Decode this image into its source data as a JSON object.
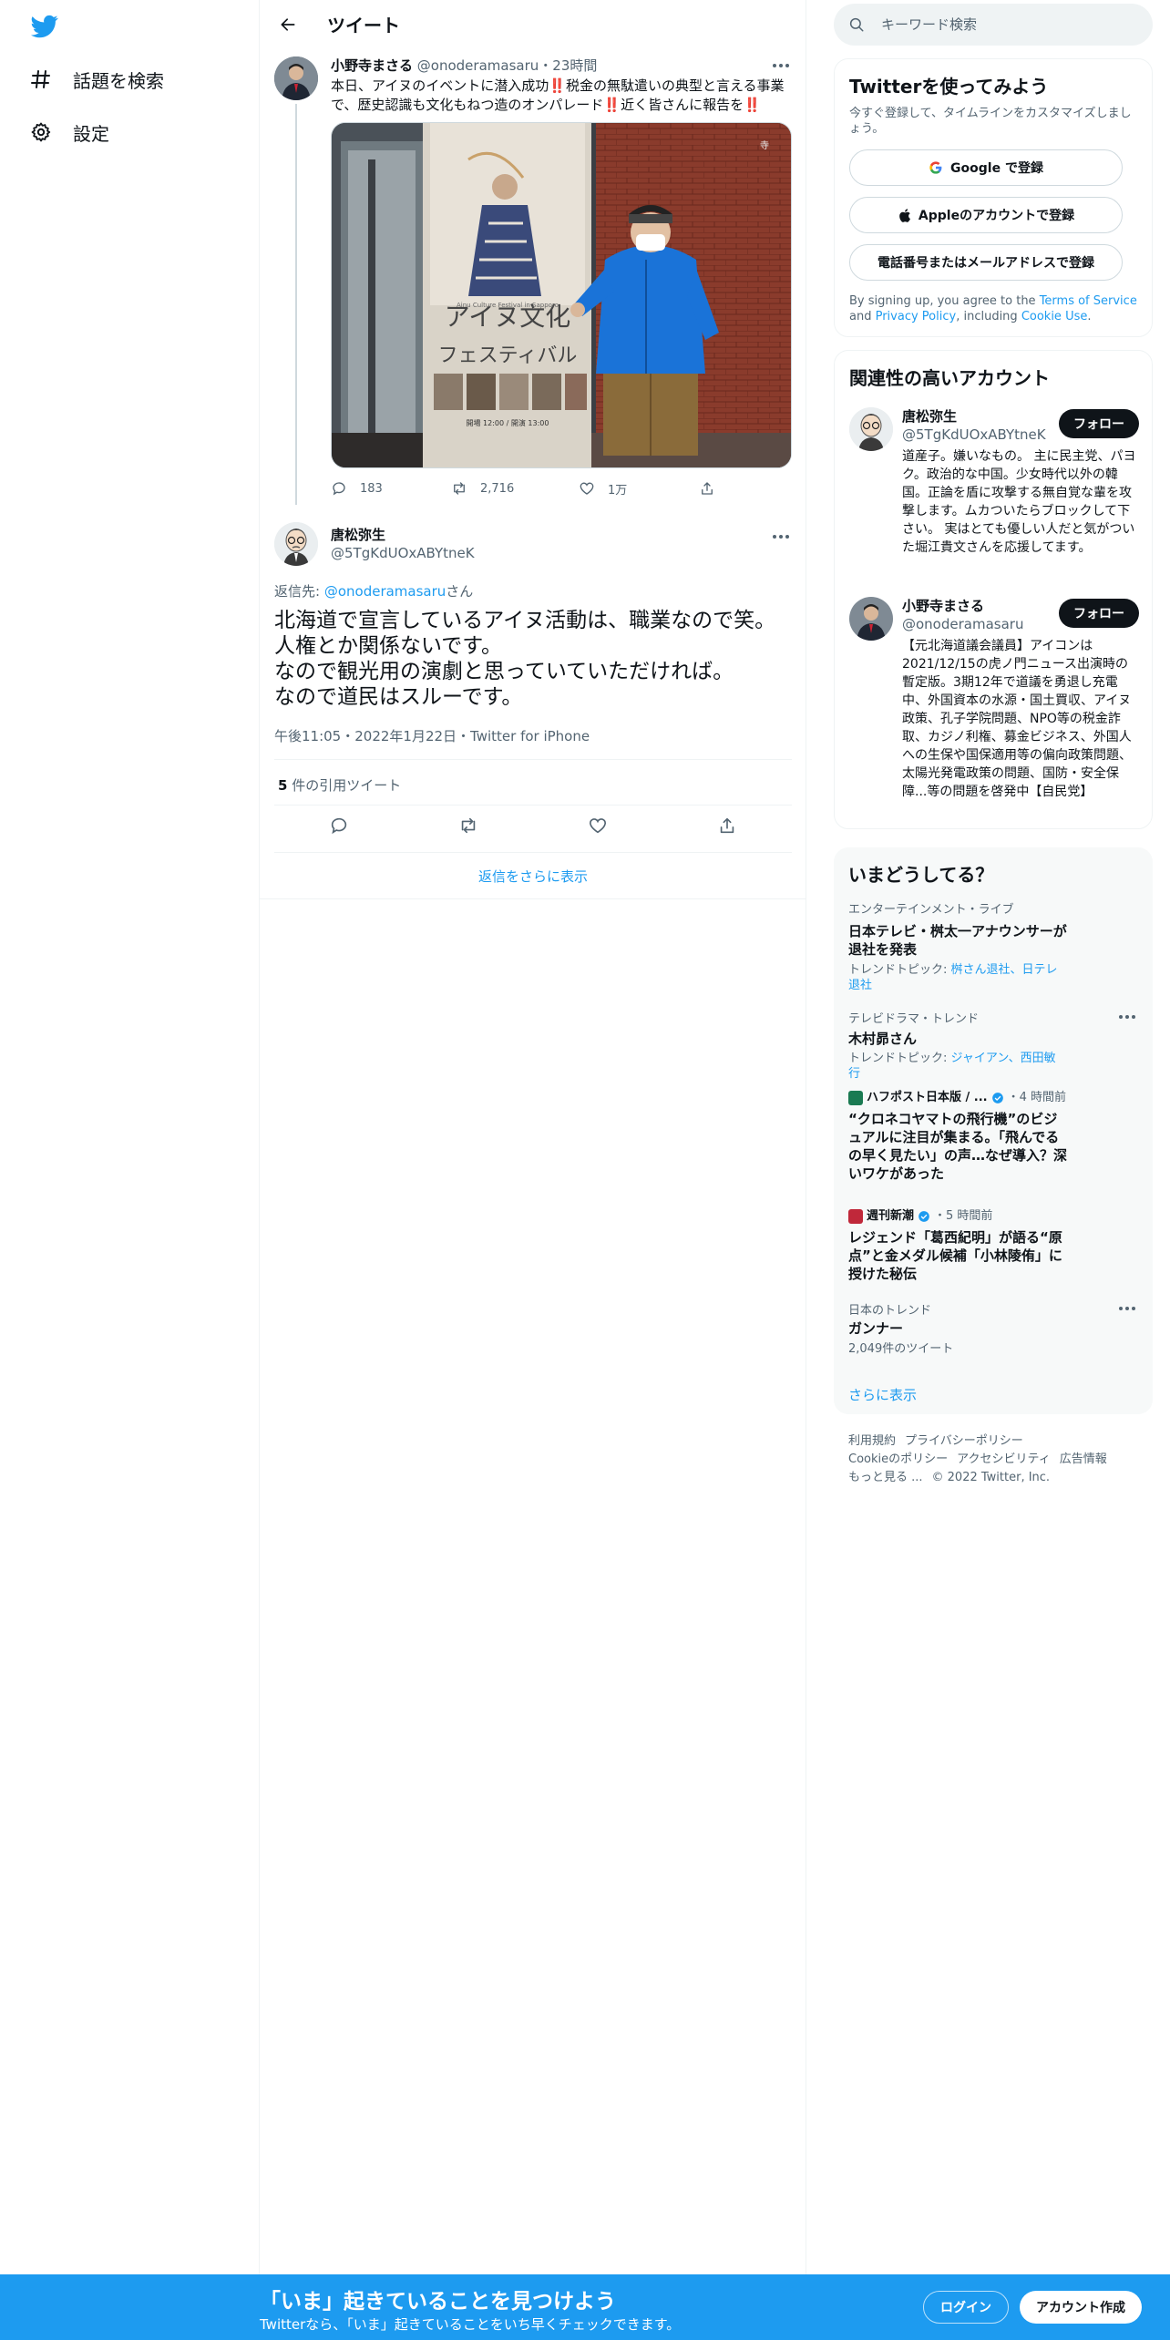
{
  "nav": {
    "items": [
      {
        "label": "話題を検索",
        "icon": "hashtag-icon"
      },
      {
        "label": "設定",
        "icon": "gear-icon"
      }
    ]
  },
  "header": {
    "title": "ツイート"
  },
  "tweet1": {
    "name": "小野寺まさる",
    "handle": "@onoderamasaru",
    "time": "23時間",
    "text_parts": [
      "本日、アイヌのイベントに潜入成功",
      "‼️",
      "税金の無駄遣いの典型と言える事業で、歴史認識も文化もねつ造のオンパレード",
      "‼️",
      "近く皆さんに報告を",
      "‼️"
    ],
    "photo": {
      "poster_title_1": "アイヌ文化",
      "poster_title_2": "フェスティバル",
      "poster_en": "Ainu Culture Festival in Sapporo",
      "poster_date": "開場 12:00 / 開演 13:00"
    },
    "replies": "183",
    "retweets": "2,716",
    "likes": "1万"
  },
  "tweet2": {
    "name": "唐松弥生",
    "handle": "@5TgKdUOxABYtneK",
    "reply_prefix": "返信先: ",
    "reply_handle": "@onoderamasaru",
    "reply_suffix": "さん",
    "lines": [
      "北海道で宣言しているアイヌ活動は、職業なので笑。",
      "人権とか関係ないです。",
      "なので観光用の演劇と思っていていただければ。",
      "なので道民はスルーです。"
    ],
    "meta": "午後11:05・2022年1月22日・Twitter for iPhone",
    "quote_count": "5",
    "quote_label": " 件の引用ツイート",
    "show_more_replies": "返信をさらに表示"
  },
  "search": {
    "placeholder": "キーワード検索"
  },
  "signup_card": {
    "title": "Twitterを使ってみよう",
    "subtitle": "今すぐ登録して、タイムラインをカスタマイズしましょう。",
    "google": "Google で登録",
    "apple": "Appleのアカウントで登録",
    "phone": "電話番号またはメールアドレスで登録",
    "terms_1": "By signing up, you agree to the ",
    "terms_link1": "Terms of Service",
    "terms_2": " and ",
    "terms_link2": "Privacy Policy",
    "terms_3": ", including ",
    "terms_link3": "Cookie Use",
    "terms_4": "."
  },
  "related": {
    "title": "関連性の高いアカウント",
    "users": [
      {
        "name": "唐松弥生",
        "handle": "@5TgKdUOxABYtneK",
        "follow": "フォロー",
        "bio": "道産子。嫌いなもの。 主に民主党、パヨク。政治的な中国。少女時代以外の韓国。正論を盾に攻撃する無自覚な輩を攻撃します。ムカついたらブロックして下さい。 実はとても優しい人だと気がついた堀江貴文さんを応援してます。"
      },
      {
        "name": "小野寺まさる",
        "handle": "@onoderamasaru",
        "follow": "フォロー",
        "bio": "【元北海道議会議員】アイコンは2021/12/15の虎ノ門ニュース出演時の暫定版。3期12年で道議を勇退し充電中、外国資本の水源・国土買収、アイヌ政策、孔子学院問題、NPO等の税金詐取、カジノ利権、募金ビジネス、外国人への生保や国保適用等の偏向政策問題、太陽光発電政策の問題、国防・安全保障...等の問題を啓発中【自民党】"
      }
    ]
  },
  "trends": {
    "title": "いまどうしてる？",
    "items": [
      {
        "context": "エンターテインメント・ライブ",
        "title": "日本テレビ・桝太一アナウンサーが退社を発表",
        "topic_prefix": "トレンドトピック: ",
        "topic_links": "桝さん退社、日テレ退社"
      },
      {
        "context": "テレビドラマ・トレンド",
        "title": "木村昴さん",
        "topic_prefix": "トレンドトピック: ",
        "topic_links": "ジャイアン、西田敏行"
      },
      {
        "source": "ハフポスト日本版 / ...",
        "time": "・4 時間前",
        "title": "“クロネコヤマトの飛行機”のビジュアルに注目が集まる。「飛んでるの早く見たい」の声…なぜ導入？深いワケがあった"
      },
      {
        "source": "週刊新潮",
        "time": "・5 時間前",
        "title": "レジェンド「葛西紀明」が語る“原点”と金メダル候補「小林陵侑」に授けた秘伝"
      },
      {
        "context": "日本のトレンド",
        "title": "ガンナー",
        "count": "2,049件のツイート"
      }
    ],
    "show_more": "さらに表示"
  },
  "footer": {
    "links": [
      "利用規約",
      "プライバシーポリシー",
      "Cookieのポリシー",
      "アクセシビリティ",
      "広告情報",
      "もっと見る ..."
    ],
    "copyright": "© 2022 Twitter, Inc."
  },
  "bottom_bar": {
    "title": "「いま」起きていることを見つけよう",
    "subtitle": "Twitterなら、「いま」起きていることをいち早くチェックできます。",
    "login": "ログイン",
    "signup": "アカウント作成"
  },
  "colors": {
    "accent": "#1d9bf0",
    "text": "#0f1419",
    "secondary": "#536471",
    "border": "#eff3f4"
  }
}
